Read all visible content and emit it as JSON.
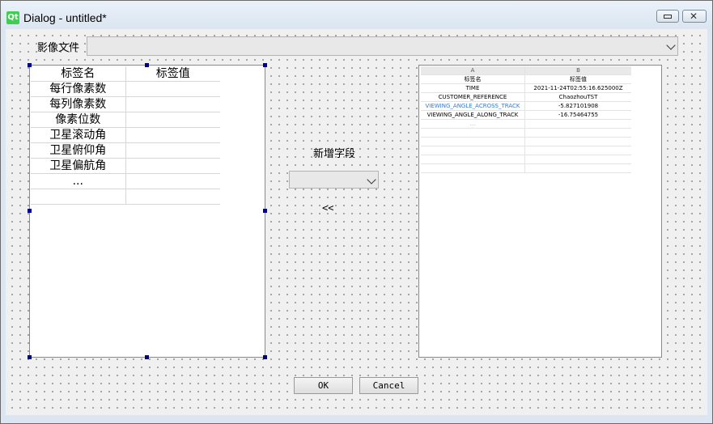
{
  "window": {
    "title": "Dialog - untitled*",
    "logo": "Qt"
  },
  "form": {
    "file_label": "影像文件",
    "file_value": "",
    "new_field_label": "新增字段",
    "new_field_value": "",
    "move_left_label": "<<",
    "ok_label": "OK",
    "cancel_label": "Cancel"
  },
  "left_table": {
    "headers": [
      "标签名",
      "标签值"
    ],
    "rows": [
      [
        "每行像素数",
        ""
      ],
      [
        "每列像素数",
        ""
      ],
      [
        "像素位数",
        ""
      ],
      [
        "卫星滚动角",
        ""
      ],
      [
        "卫星俯仰角",
        ""
      ],
      [
        "卫星偏航角",
        ""
      ],
      [
        "...",
        ""
      ],
      [
        "",
        ""
      ]
    ]
  },
  "sheet_preview": {
    "columns": [
      "A",
      "B"
    ],
    "headers": [
      "标签名",
      "标签值"
    ],
    "rows": [
      [
        "TIME",
        "2021-11-24T02:55:16.625000Z"
      ],
      [
        "CUSTOMER_REFERENCE",
        "ChaozhouTST"
      ],
      [
        "VIEWING_ANGLE_ACROSS_TRACK",
        "-5.827101908"
      ],
      [
        "VIEWING_ANGLE_ALONG_TRACK",
        "-16.75464755"
      ],
      [
        "...",
        ""
      ]
    ]
  }
}
